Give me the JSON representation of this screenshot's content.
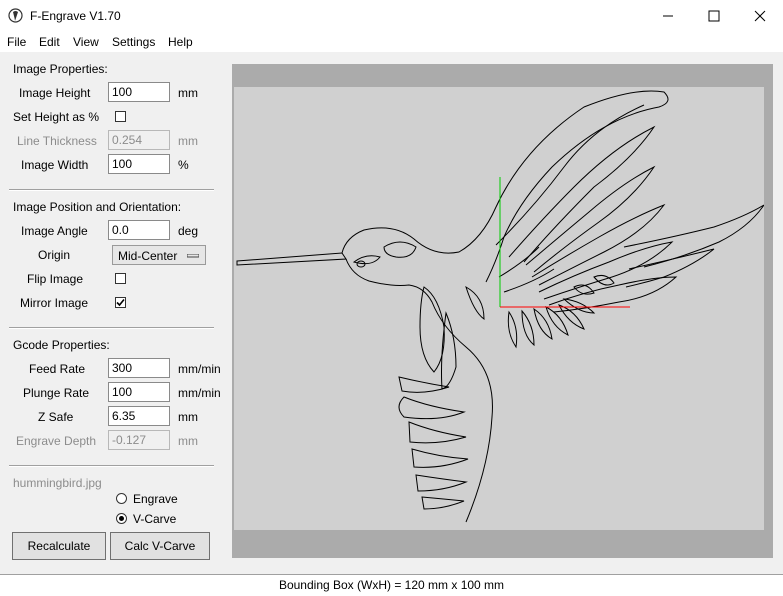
{
  "window": {
    "title": "F-Engrave V1.70"
  },
  "menu": [
    "File",
    "Edit",
    "View",
    "Settings",
    "Help"
  ],
  "image_properties": {
    "heading": "Image Properties:",
    "height_label": "Image Height",
    "height_value": "100",
    "height_unit": "mm",
    "set_height_pct_label": "Set Height as %",
    "set_height_pct_checked": false,
    "line_thickness_label": "Line Thickness",
    "line_thickness_value": "0.254",
    "line_thickness_unit": "mm",
    "width_label": "Image Width",
    "width_value": "100",
    "width_unit": "%"
  },
  "position": {
    "heading": "Image Position and Orientation:",
    "angle_label": "Image Angle",
    "angle_value": "0.0",
    "angle_unit": "deg",
    "origin_label": "Origin",
    "origin_value": "Mid-Center",
    "flip_label": "Flip Image",
    "flip_checked": false,
    "mirror_label": "Mirror Image",
    "mirror_checked": true
  },
  "gcode": {
    "heading": "Gcode Properties:",
    "feed_label": "Feed Rate",
    "feed_value": "300",
    "feed_unit": "mm/min",
    "plunge_label": "Plunge Rate",
    "plunge_value": "100",
    "plunge_unit": "mm/min",
    "zsafe_label": "Z Safe",
    "zsafe_value": "6.35",
    "zsafe_unit": "mm",
    "depth_label": "Engrave Depth",
    "depth_value": "-0.127",
    "depth_unit": "mm"
  },
  "mode": {
    "filename": "hummingbird.jpg",
    "engrave_label": "Engrave",
    "vcarve_label": "V-Carve",
    "selected": "V-Carve"
  },
  "buttons": {
    "recalculate": "Recalculate",
    "calc_vcarve": "Calc V-Carve"
  },
  "status": {
    "text": "Bounding Box (WxH) = 120 mm  x 100 mm"
  },
  "colors": {
    "x_axis": "#ff0000",
    "y_axis": "#00cc00",
    "canvas_bg": "#d0d0d0",
    "canvas_frame": "#ababab"
  }
}
